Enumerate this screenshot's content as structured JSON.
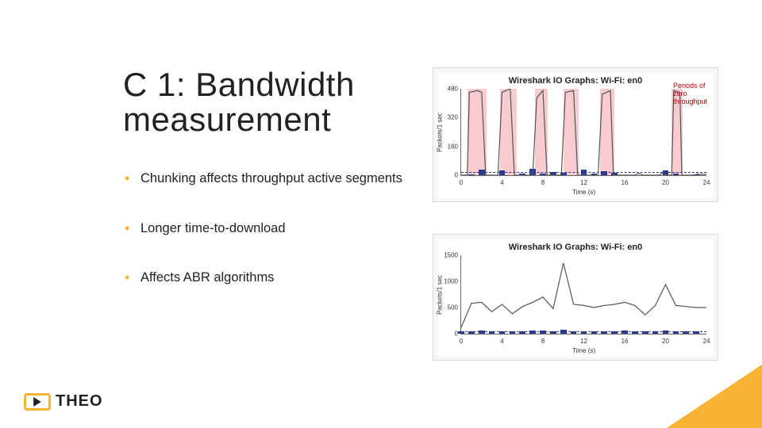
{
  "title": "C 1: Bandwidth measurement",
  "bullets": [
    "Chunking affects throughput active segments",
    "Longer time-to-download",
    "Affects ABR algorithms"
  ],
  "logo_text": "THEO",
  "annotation_top": "Periods of zero throughput",
  "chart_data": [
    {
      "type": "line",
      "title": "Wireshark IO Graphs: Wi-Fi: en0",
      "xlabel": "Time (s)",
      "ylabel": "Packets/1 sec",
      "ylim": [
        0,
        480
      ],
      "xlim": [
        0,
        24
      ],
      "xticks": [
        0,
        4,
        8,
        12,
        16,
        20,
        24
      ],
      "yticks": [
        0,
        160,
        320,
        480
      ],
      "series": [
        {
          "name": "packets",
          "values": [
            [
              0.0,
              0
            ],
            [
              0.6,
              0
            ],
            [
              0.8,
              460
            ],
            [
              1.6,
              470
            ],
            [
              2.0,
              460
            ],
            [
              2.4,
              0
            ],
            [
              3.6,
              0
            ],
            [
              4.0,
              460
            ],
            [
              4.8,
              480
            ],
            [
              5.2,
              0
            ],
            [
              7.0,
              0
            ],
            [
              7.4,
              430
            ],
            [
              8.0,
              470
            ],
            [
              8.4,
              0
            ],
            [
              9.8,
              0
            ],
            [
              10.2,
              460
            ],
            [
              11.0,
              470
            ],
            [
              11.4,
              0
            ],
            [
              13.4,
              0
            ],
            [
              13.8,
              450
            ],
            [
              14.6,
              470
            ],
            [
              14.9,
              0
            ],
            [
              17.0,
              0
            ],
            [
              17.4,
              10
            ],
            [
              17.8,
              0
            ],
            [
              19.4,
              0
            ],
            [
              19.6,
              10
            ],
            [
              20.0,
              0
            ],
            [
              20.6,
              0
            ],
            [
              20.8,
              470
            ],
            [
              21.4,
              460
            ],
            [
              21.6,
              0
            ],
            [
              22.8,
              0
            ],
            [
              23.0,
              5
            ],
            [
              24.0,
              5
            ]
          ]
        }
      ],
      "bars": {
        "values": [
          [
            1,
            5
          ],
          [
            2,
            30
          ],
          [
            4,
            25
          ],
          [
            6,
            10
          ],
          [
            7,
            35
          ],
          [
            8,
            8
          ],
          [
            9,
            18
          ],
          [
            10,
            12
          ],
          [
            12,
            30
          ],
          [
            13,
            10
          ],
          [
            14,
            20
          ],
          [
            15,
            12
          ],
          [
            20,
            25
          ],
          [
            21,
            10
          ],
          [
            23,
            5
          ]
        ]
      },
      "highlight_bands_x": [
        [
          0.6,
          2.5
        ],
        [
          3.8,
          5.4
        ],
        [
          7.2,
          8.5
        ],
        [
          10.0,
          11.5
        ],
        [
          13.6,
          15.0
        ],
        [
          20.6,
          21.7
        ]
      ]
    },
    {
      "type": "line",
      "title": "Wireshark IO Graphs: Wi-Fi: en0",
      "xlabel": "Time (s)",
      "ylabel": "Packets/1 sec",
      "ylim": [
        0,
        1500
      ],
      "xlim": [
        0,
        24
      ],
      "xticks": [
        0,
        4,
        8,
        12,
        16,
        20,
        24
      ],
      "yticks": [
        0,
        500,
        1000,
        1500
      ],
      "series": [
        {
          "name": "packets",
          "values": [
            [
              0,
              120
            ],
            [
              1,
              580
            ],
            [
              2,
              600
            ],
            [
              3,
              420
            ],
            [
              4,
              560
            ],
            [
              5,
              380
            ],
            [
              6,
              520
            ],
            [
              7,
              600
            ],
            [
              8,
              700
            ],
            [
              9,
              480
            ],
            [
              10,
              1350
            ],
            [
              11,
              560
            ],
            [
              12,
              540
            ],
            [
              13,
              500
            ],
            [
              14,
              540
            ],
            [
              15,
              560
            ],
            [
              16,
              600
            ],
            [
              17,
              540
            ],
            [
              18,
              360
            ],
            [
              19,
              540
            ],
            [
              20,
              940
            ],
            [
              21,
              540
            ],
            [
              22,
              520
            ],
            [
              23,
              500
            ],
            [
              24,
              500
            ]
          ]
        }
      ],
      "bars": {
        "values": [
          [
            0,
            50
          ],
          [
            1,
            48
          ],
          [
            2,
            55
          ],
          [
            3,
            45
          ],
          [
            4,
            52
          ],
          [
            5,
            50
          ],
          [
            6,
            48
          ],
          [
            7,
            55
          ],
          [
            8,
            58
          ],
          [
            9,
            50
          ],
          [
            10,
            70
          ],
          [
            11,
            52
          ],
          [
            12,
            50
          ],
          [
            13,
            48
          ],
          [
            14,
            50
          ],
          [
            15,
            52
          ],
          [
            16,
            55
          ],
          [
            17,
            50
          ],
          [
            18,
            45
          ],
          [
            19,
            50
          ],
          [
            20,
            60
          ],
          [
            21,
            52
          ],
          [
            22,
            50
          ],
          [
            23,
            48
          ]
        ]
      }
    }
  ]
}
